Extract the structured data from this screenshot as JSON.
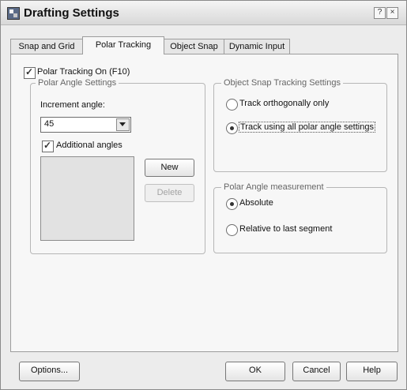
{
  "window": {
    "title": "Drafting Settings",
    "help_button": "?",
    "close_button": "×"
  },
  "tabs": [
    {
      "label": "Snap and Grid",
      "active": false
    },
    {
      "label": "Polar Tracking",
      "active": true
    },
    {
      "label": "Object Snap",
      "active": false
    },
    {
      "label": "Dynamic Input",
      "active": false
    }
  ],
  "polar_tracking": {
    "enabled_label": "Polar Tracking On (F10)",
    "enabled": true
  },
  "polar_angle_settings": {
    "title": "Polar Angle Settings",
    "increment_label": "Increment angle:",
    "increment_value": "45",
    "additional_angles_label": "Additional angles",
    "additional_angles_checked": false,
    "new_button": "New",
    "delete_button": "Delete"
  },
  "object_snap_tracking": {
    "title": "Object Snap Tracking Settings",
    "options": [
      {
        "label": "Track orthogonally only",
        "selected": false
      },
      {
        "label": "Track using all polar angle settings",
        "selected": true
      }
    ]
  },
  "polar_angle_measurement": {
    "title": "Polar Angle measurement",
    "options": [
      {
        "label": "Absolute",
        "selected": true
      },
      {
        "label": "Relative to last segment",
        "selected": false
      }
    ]
  },
  "footer": {
    "options_button": "Options...",
    "ok_button": "OK",
    "cancel_button": "Cancel",
    "help_button": "Help"
  }
}
